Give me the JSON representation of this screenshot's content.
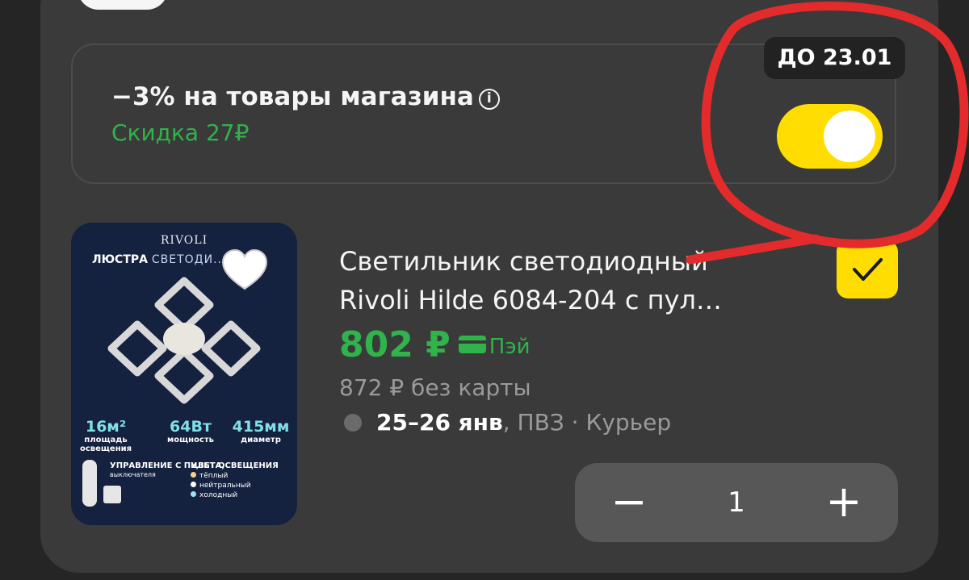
{
  "promo": {
    "title": "−3% на товары магазина",
    "info_icon": "info-icon",
    "discount": "Скидка 27₽",
    "until": "ДО 23.01",
    "toggle_on": true,
    "accent_color": "#ffdd00",
    "discount_color": "#2fb34a"
  },
  "product": {
    "image": {
      "brand": "RIVOLI",
      "heading_bold": "ЛЮСТРА",
      "heading_rest": "СВЕТОДИ... ЯЯ",
      "favorite_icon": "heart-icon",
      "specs": [
        {
          "value": "16м²",
          "label1": "площадь",
          "label2": "освещения"
        },
        {
          "value": "64Вт",
          "label1": "мощность",
          "label2": ""
        },
        {
          "value": "415мм",
          "label1": "диаметр",
          "label2": ""
        }
      ],
      "control_title": "УПРАВЛЕНИЕ С ПУЛЬТА,",
      "control_sub": "выключателя",
      "colors_title": "ЦВЕТ ОСВЕЩЕНИЯ",
      "color_options": [
        "тёплый",
        "нейтральный",
        "холодный"
      ]
    },
    "title_line1": "Светильник светодиодный",
    "title_line2": "Rivoli Hilde 6084-204 с пул…",
    "selected": true,
    "price": "802 ₽",
    "pay_label": "Пэй",
    "old_price": "872 ₽ без карты",
    "delivery_date": "25–26 янв",
    "delivery_rest": ", ПВЗ · Курьер",
    "quantity": "1",
    "minus_label": "−",
    "plus_label": "+"
  }
}
